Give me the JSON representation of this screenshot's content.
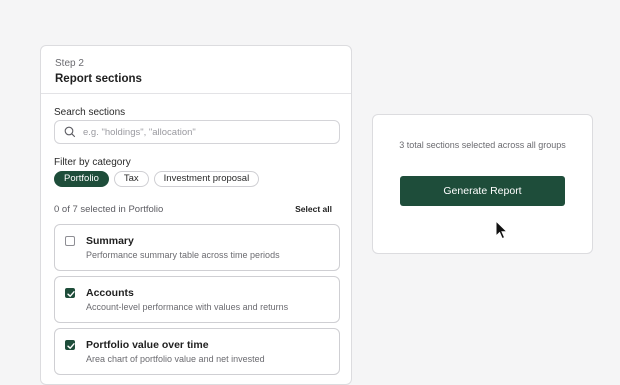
{
  "left_card": {
    "step": "Step 2",
    "title": "Report sections",
    "search_label": "Search sections",
    "search_placeholder": "e.g. \"holdings\", \"allocation\"",
    "search_value": "",
    "filter_label": "Filter by category",
    "chips": [
      {
        "label": "Portfolio",
        "active": true
      },
      {
        "label": "Tax",
        "active": false
      },
      {
        "label": "Investment proposal",
        "active": false
      }
    ],
    "selected_count": "0 of 7 selected in Portfolio",
    "select_all": "Select all",
    "sections": [
      {
        "title": "Summary",
        "description": "Performance summary table across time periods",
        "checked": false
      },
      {
        "title": "Accounts",
        "description": "Account-level performance with values and returns",
        "checked": true
      },
      {
        "title": "Portfolio value over time",
        "description": "Area chart of portfolio value and net invested",
        "checked": true
      }
    ]
  },
  "right_card": {
    "total_text": "3 total sections selected across all groups",
    "button_label": "Generate Report"
  },
  "colors": {
    "accent": "#1e4d3a",
    "background": "#f5f5f6"
  }
}
